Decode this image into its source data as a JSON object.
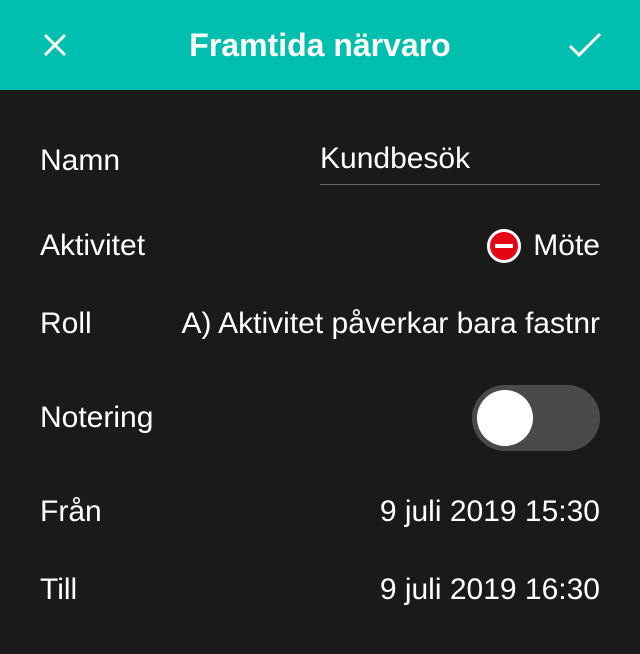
{
  "header": {
    "title": "Framtida närvaro"
  },
  "form": {
    "name": {
      "label": "Namn",
      "value": "Kundbesök"
    },
    "activity": {
      "label": "Aktivitet",
      "value": "Möte"
    },
    "role": {
      "label": "Roll",
      "value": "A) Aktivitet påverkar bara fastnr"
    },
    "notering": {
      "label": "Notering",
      "enabled": false
    },
    "from": {
      "label": "Från",
      "value": "9 juli 2019 15:30"
    },
    "to": {
      "label": "Till",
      "value": "9 juli 2019 16:30"
    }
  }
}
